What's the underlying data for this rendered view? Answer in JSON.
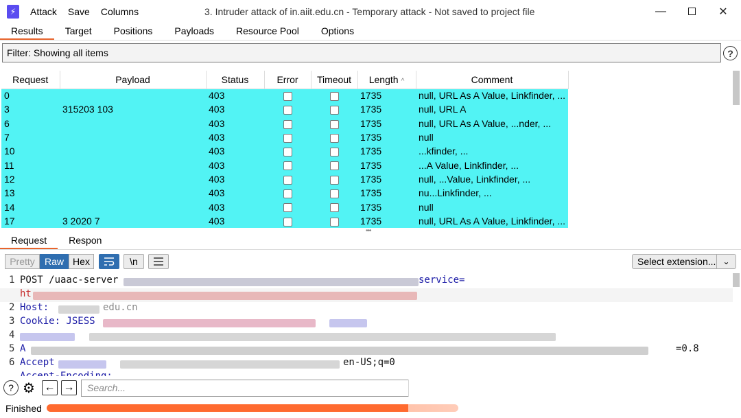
{
  "window": {
    "menu": [
      "Attack",
      "Save",
      "Columns"
    ],
    "title": "3. Intruder attack of in.aiit.edu.cn - Temporary attack - Not saved to project file",
    "min": "—",
    "close": "✕"
  },
  "tabs": [
    "Results",
    "Target",
    "Positions",
    "Payloads",
    "Resource Pool",
    "Options"
  ],
  "filter": {
    "label": "Filter: Showing all items",
    "help": "?"
  },
  "table": {
    "columns": [
      "Request",
      "Payload",
      "Status",
      "Error",
      "Timeout",
      "Length",
      "Comment"
    ],
    "sort_arrow": "^",
    "row_color": "#52f3f4",
    "rows": [
      {
        "request": "0",
        "payload": "",
        "status": "403",
        "length": "1735",
        "comment": "null, URL As A Value, Linkfinder, ..."
      },
      {
        "request": "3",
        "payload": "315203 103",
        "status": "403",
        "length": "1735",
        "comment": "null, URL A"
      },
      {
        "request": "6",
        "payload": "",
        "status": "403",
        "length": "1735",
        "comment": "null, URL As A Value, ...nder, ..."
      },
      {
        "request": "7",
        "payload": "",
        "status": "403",
        "length": "1735",
        "comment": "null"
      },
      {
        "request": "10",
        "payload": "",
        "status": "403",
        "length": "1735",
        "comment": "...kfinder, ..."
      },
      {
        "request": "11",
        "payload": "",
        "status": "403",
        "length": "1735",
        "comment": "...A Value, Linkfinder, ..."
      },
      {
        "request": "12",
        "payload": "",
        "status": "403",
        "length": "1735",
        "comment": "null, ...Value, Linkfinder, ..."
      },
      {
        "request": "13",
        "payload": "",
        "status": "403",
        "length": "1735",
        "comment": "nu...Linkfinder, ..."
      },
      {
        "request": "14",
        "payload": "",
        "status": "403",
        "length": "1735",
        "comment": "null"
      },
      {
        "request": "17",
        "payload": "3 2020 7",
        "status": "403",
        "length": "1735",
        "comment": "null, URL As A Value, Linkfinder, ..."
      }
    ]
  },
  "lower_tabs": [
    "Request",
    "Respon"
  ],
  "toolbar": {
    "pretty": "Pretty",
    "raw": "Raw",
    "hex": "Hex",
    "newline": "\\n",
    "select_extension": "Select extension...",
    "chevron": "⌄"
  },
  "editor": {
    "lines": [
      {
        "n": "1",
        "text": "POST /uaac-server",
        "tail": "service="
      },
      {
        "n": "",
        "text": "ht",
        "tail": ""
      },
      {
        "n": "2",
        "text": "Host:",
        "tail": "edu.cn"
      },
      {
        "n": "3",
        "text": "Cookie: JSESS",
        "tail": ""
      },
      {
        "n": "4",
        "text": "",
        "tail": ""
      },
      {
        "n": "5",
        "text": "A",
        "tail": "=0.8"
      },
      {
        "n": "6",
        "text": "Accept",
        "tail": "en-US;q=0"
      },
      {
        "n": "",
        "text": "Accept-Encoding:",
        "tail": ""
      }
    ]
  },
  "bottom": {
    "help": "?",
    "settings": "⚙",
    "back": "←",
    "forward": "→",
    "search_placeholder": "Search..."
  },
  "status": {
    "text": "Finished",
    "progress": 1.0,
    "accent": "#ff6a2f"
  }
}
